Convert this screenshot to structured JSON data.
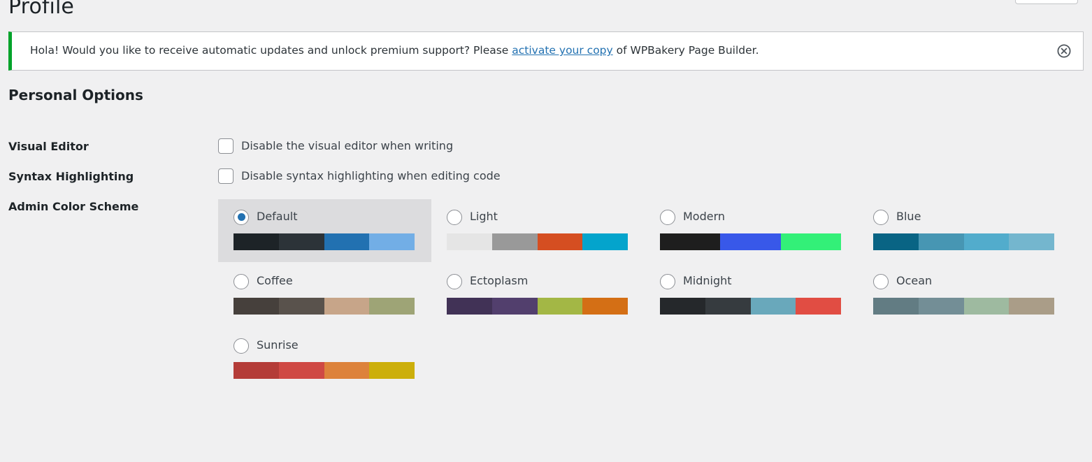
{
  "page": {
    "title": "Profile"
  },
  "screen_meta": {
    "tab_present": true
  },
  "notice": {
    "text_before_link": "Hola! Would you like to receive automatic updates and unlock premium support? Please ",
    "link_text": "activate your copy",
    "text_after_link": " of WPBakery Page Builder.",
    "accent_color": "#00a32a",
    "dismiss_icon": "dismiss-circle-x-icon"
  },
  "personal_options": {
    "heading": "Personal Options",
    "rows": [
      {
        "label": "Visual Editor",
        "checkbox_label": "Disable the visual editor when writing",
        "checked": false
      },
      {
        "label": "Syntax Highlighting",
        "checkbox_label": "Disable syntax highlighting when editing code",
        "checked": false
      }
    ],
    "admin_color_scheme": {
      "label": "Admin Color Scheme",
      "selected": "Default",
      "schemes": [
        {
          "name": "Default",
          "selected": true,
          "colors": [
            "#1d2327",
            "#2c3338",
            "#2271b1",
            "#72aee6"
          ]
        },
        {
          "name": "Light",
          "selected": false,
          "colors": [
            "#e5e5e5",
            "#999999",
            "#d54e21",
            "#04a4cc"
          ]
        },
        {
          "name": "Modern",
          "selected": false,
          "colors": [
            "#1e1e1e",
            "#3858e9",
            "#33f078"
          ]
        },
        {
          "name": "Blue",
          "selected": false,
          "colors": [
            "#096484",
            "#4796b3",
            "#52accc",
            "#74b6ce"
          ]
        },
        {
          "name": "Coffee",
          "selected": false,
          "colors": [
            "#46403c",
            "#59524c",
            "#c7a589",
            "#9ea476"
          ]
        },
        {
          "name": "Ectoplasm",
          "selected": false,
          "colors": [
            "#413256",
            "#523f6d",
            "#a3b745",
            "#d46f15"
          ]
        },
        {
          "name": "Midnight",
          "selected": false,
          "colors": [
            "#25282b",
            "#363b3f",
            "#69a8bb",
            "#e14d43"
          ]
        },
        {
          "name": "Ocean",
          "selected": false,
          "colors": [
            "#627c83",
            "#738e96",
            "#9ebaa0",
            "#aa9d88"
          ]
        },
        {
          "name": "Sunrise",
          "selected": false,
          "colors": [
            "#b43c38",
            "#cf4944",
            "#dd823b",
            "#ccaf0b"
          ]
        }
      ]
    }
  }
}
